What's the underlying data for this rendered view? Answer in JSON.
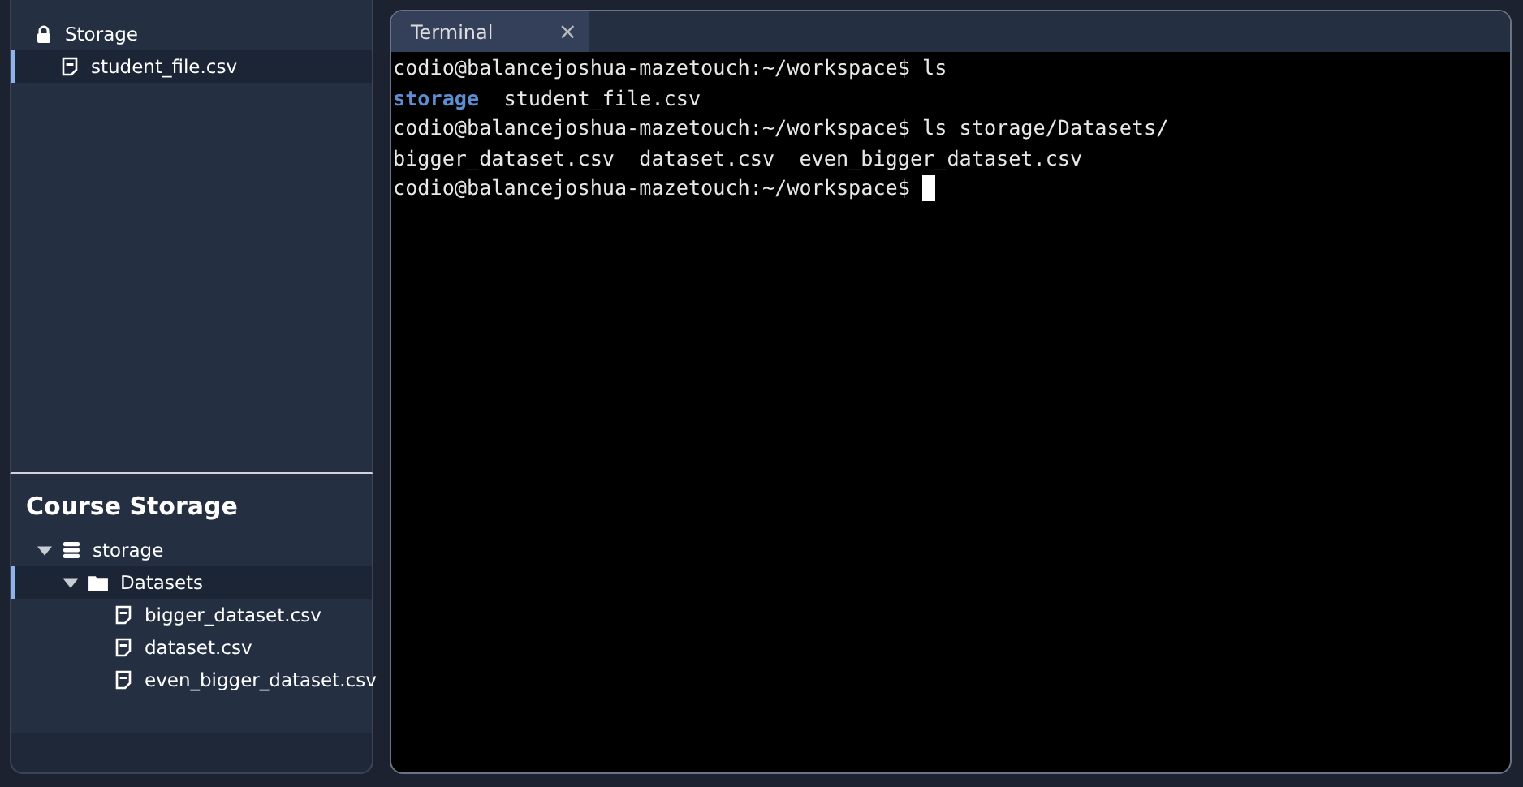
{
  "file_tree": {
    "items": [
      {
        "label": "Storage",
        "kind": "lock",
        "selected": false,
        "children": [
          {
            "label": "student_file.csv",
            "kind": "file",
            "selected": true
          }
        ]
      }
    ]
  },
  "course_storage": {
    "title": "Course Storage",
    "items": [
      {
        "label": "storage",
        "kind": "database",
        "expanded": true,
        "selected": false,
        "children": [
          {
            "label": "Datasets",
            "kind": "folder",
            "expanded": true,
            "selected": true,
            "children": [
              {
                "label": "bigger_dataset.csv",
                "kind": "file",
                "selected": false
              },
              {
                "label": "dataset.csv",
                "kind": "file",
                "selected": false
              },
              {
                "label": "even_bigger_dataset.csv",
                "kind": "file",
                "selected": false
              }
            ]
          }
        ]
      }
    ]
  },
  "terminal": {
    "tab": {
      "label": "Terminal",
      "selected": true,
      "close": "×"
    },
    "lines": [
      {
        "cursor": false,
        "segments": [
          {
            "text": "codio@balancejoshua-mazetouch:~/workspace$ ls",
            "kind": "plain"
          }
        ]
      },
      {
        "cursor": false,
        "segments": [
          {
            "text": "storage",
            "kind": "dir"
          },
          {
            "text": "  student_file.csv",
            "kind": "plain"
          }
        ]
      },
      {
        "cursor": false,
        "segments": [
          {
            "text": "codio@balancejoshua-mazetouch:~/workspace$ ls storage/Datasets/",
            "kind": "plain"
          }
        ]
      },
      {
        "cursor": false,
        "segments": [
          {
            "text": "bigger_dataset.csv  dataset.csv  even_bigger_dataset.csv",
            "kind": "plain"
          }
        ]
      },
      {
        "cursor": true,
        "segments": [
          {
            "text": "codio@balancejoshua-mazetouch:~/workspace$ ",
            "kind": "plain"
          }
        ]
      }
    ]
  }
}
